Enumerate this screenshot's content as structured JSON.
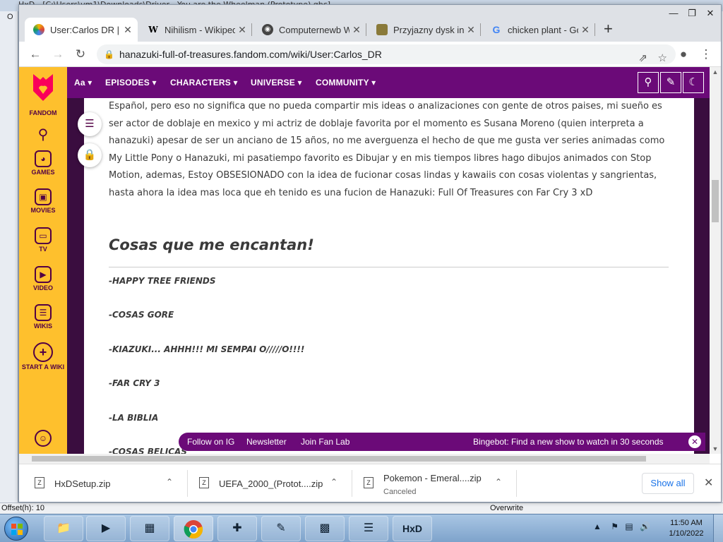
{
  "hxd": {
    "title": "HxD - [C:\\Users\\vm1\\Downloads\\Driver - You are the Wheelman (Prototype).gbc]",
    "offset": "Offset(h): 10",
    "mode": "Overwrite"
  },
  "browser": {
    "tabs": [
      {
        "label": "User:Carlos DR | H",
        "icon": "fandom-favicon"
      },
      {
        "label": "Nihilism - Wikiped",
        "icon": "wikipedia-favicon"
      },
      {
        "label": "Computernewb W",
        "icon": "computernewb-favicon"
      },
      {
        "label": "Przyjazny dysk int",
        "icon": "game-favicon"
      },
      {
        "label": "chicken plant - Go",
        "icon": "google-favicon"
      }
    ],
    "url": "hanazuki-full-of-treasures.fandom.com/wiki/User:Carlos_DR"
  },
  "fandom": {
    "rail": [
      {
        "label": "FANDOM",
        "icon": "fandom-heart-icon"
      },
      {
        "label": "",
        "icon": "search-icon"
      },
      {
        "label": "GAMES",
        "icon": "gamepad-icon"
      },
      {
        "label": "MOVIES",
        "icon": "movies-icon"
      },
      {
        "label": "TV",
        "icon": "tv-icon"
      },
      {
        "label": "VIDEO",
        "icon": "video-icon"
      },
      {
        "label": "WIKIS",
        "icon": "wikis-icon"
      },
      {
        "label": "START A WIKI",
        "icon": "plus-icon"
      }
    ],
    "nav": [
      "EPISODES",
      "CHARACTERS",
      "UNIVERSE",
      "COMMUNITY"
    ],
    "nav_logo": "Aa"
  },
  "article": {
    "paragraph": "Español, pero eso no significa que no pueda compartir mis ideas o analizaciones con gente de otros paises, mi sueño es ser actor de doblaje en mexico y mi actriz de doblaje favorita por el momento es Susana Moreno (quien interpreta a hanazuki) apesar de ser un anciano de 15 años, no me averguenza el hecho de que me gusta ver series animadas como My Little Pony o Hanazuki, mi pasatiempo favorito es Dibujar y en mis tiempos libres hago dibujos animados con Stop Motion, ademas, Estoy OBSESIONADO con la idea de fucionar cosas lindas y kawaiis con cosas violentas y sangrientas, hasta ahora la idea mas loca que eh tenido es una fucion de Hanazuki: Full Of Treasures con Far Cry 3 xD",
    "heading": "Cosas que me encantan!",
    "items": [
      "-HAPPY TREE FRIENDS",
      "-COSAS GORE",
      "-KIAZUKI... AHHH!!! MI SEMPAI O/////O!!!!",
      "-FAR CRY 3",
      "-LA BIBLIA",
      "-COSAS BELICAS"
    ]
  },
  "bingebar": {
    "links": [
      "Follow on IG",
      "Newsletter",
      "Join Fan Lab"
    ],
    "message": "Bingebot: Find a new show to watch in 30 seconds"
  },
  "downloads": {
    "items": [
      {
        "name": "HxDSetup.zip",
        "status": ""
      },
      {
        "name": "UEFA_2000_(Protot....zip",
        "status": ""
      },
      {
        "name": "Pokemon - Emeral....zip",
        "status": "Canceled"
      }
    ],
    "show_all": "Show all"
  },
  "taskbar": {
    "time": "11:50 AM",
    "date": "1/10/2022"
  },
  "colors": {
    "fandom_yellow": "#fec02d",
    "fandom_purple": "#6b0a78",
    "fandom_dark": "#3a0d3f"
  }
}
